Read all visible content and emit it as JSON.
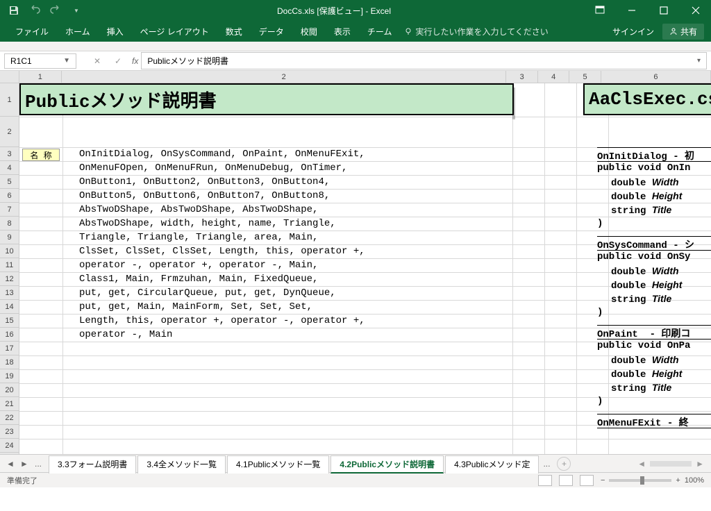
{
  "titlebar": {
    "title": "DocCs.xls  [保護ビュー] - Excel"
  },
  "ribbon": {
    "tabs": [
      "ファイル",
      "ホーム",
      "挿入",
      "ページ レイアウト",
      "数式",
      "データ",
      "校閲",
      "表示",
      "チーム"
    ],
    "tell": "実行したい作業を入力してください",
    "signin": "サインイン",
    "share": "共有"
  },
  "namebox": "R1C1",
  "formula": "Publicメソッド説明書",
  "columns": [
    "1",
    "2",
    "3",
    "4",
    "5",
    "6"
  ],
  "rows": [
    "1",
    "2",
    "3",
    "4",
    "5",
    "6",
    "7",
    "8",
    "9",
    "10",
    "11",
    "12",
    "13",
    "14",
    "15",
    "16",
    "17",
    "18",
    "19",
    "20",
    "21",
    "22",
    "23",
    "24"
  ],
  "title_cell": "Publicメソッド説明書",
  "title_cell2": "AaClsExec.cs",
  "label": "名 称",
  "methods": [
    "OnInitDialog, OnSysCommand, OnPaint, OnMenuFExit,",
    "OnMenuFOpen, OnMenuFRun, OnMenuDebug, OnTimer,",
    "OnButton1, OnButton2, OnButton3, OnButton4,",
    "OnButton5, OnButton6, OnButton7, OnButton8,",
    "AbsTwoDShape, AbsTwoDShape, AbsTwoDShape,",
    "AbsTwoDShape, width, height, name, Triangle,",
    "Triangle, Triangle, Triangle, area, Main,",
    "ClsSet, ClsSet, ClsSet, Length, this, operator +,",
    "operator -, operator +, operator -, Main,",
    "Class1, Main, Frmzuhan, Main, FixedQueue,",
    "put, get, CircularQueue, put, get, DynQueue,",
    "put, get, Main, MainForm, Set, Set, Set,",
    "Length, this, operator +, operator -, operator +,",
    "operator -, Main"
  ],
  "right_blocks": [
    {
      "head": "OnInitDialog - 初",
      "sig": "public void OnIn",
      "p": [
        "double Width",
        "double Height",
        "string Title"
      ],
      "end": ")"
    },
    {
      "head": "OnSysCommand - シ",
      "sig": "public void OnSy",
      "p": [
        "double Width",
        "double Height",
        "string Title"
      ],
      "end": ")"
    },
    {
      "head": "OnPaint  - 印刷コ",
      "sig": "public void OnPa",
      "p": [
        "double Width",
        "double Height",
        "string Title"
      ],
      "end": ")"
    },
    {
      "head": "OnMenuFExit - 終"
    }
  ],
  "sheet_tabs": [
    "3.3フォーム説明書",
    "3.4全メソッド一覧",
    "4.1Publicメソッド一覧",
    "4.2Publicメソッド説明書",
    "4.3Publicメソッド定"
  ],
  "active_tab": 3,
  "ellipsis": "...",
  "status": "準備完了",
  "zoom": "100%"
}
